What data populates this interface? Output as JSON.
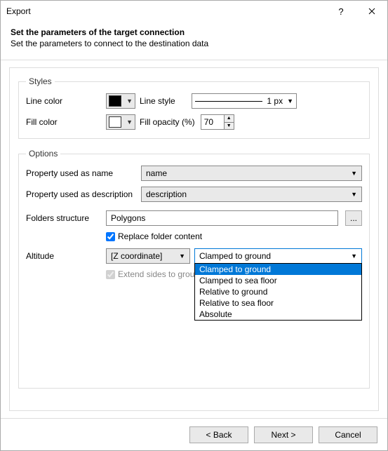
{
  "title": "Export",
  "header": {
    "bold": "Set the parameters of the target connection",
    "sub": "Set the parameters to connect to the destination data"
  },
  "styles": {
    "legend": "Styles",
    "line_color_label": "Line color",
    "line_style_label": "Line style",
    "line_style_value": "1 px",
    "fill_color_label": "Fill color",
    "fill_opacity_label": "Fill opacity (%)",
    "fill_opacity_value": "70",
    "line_color": "#000000",
    "fill_color": "#ffffff"
  },
  "options": {
    "legend": "Options",
    "prop_name_label": "Property used as name",
    "prop_name_value": "name",
    "prop_desc_label": "Property used as description",
    "prop_desc_value": "description",
    "folders_label": "Folders structure",
    "folders_value": "Polygons",
    "browse_label": "...",
    "replace_label": "Replace folder content",
    "replace_checked": true,
    "altitude_label": "Altitude",
    "altitude_source": "[Z coordinate]",
    "altitude_mode_selected": "Clamped to ground",
    "altitude_modes": [
      "Clamped to ground",
      "Clamped to sea floor",
      "Relative to ground",
      "Relative to sea floor",
      "Absolute"
    ],
    "extend_label": "Extend sides to ground",
    "extend_checked": true
  },
  "footer": {
    "back": "< Back",
    "next": "Next >",
    "cancel": "Cancel"
  }
}
